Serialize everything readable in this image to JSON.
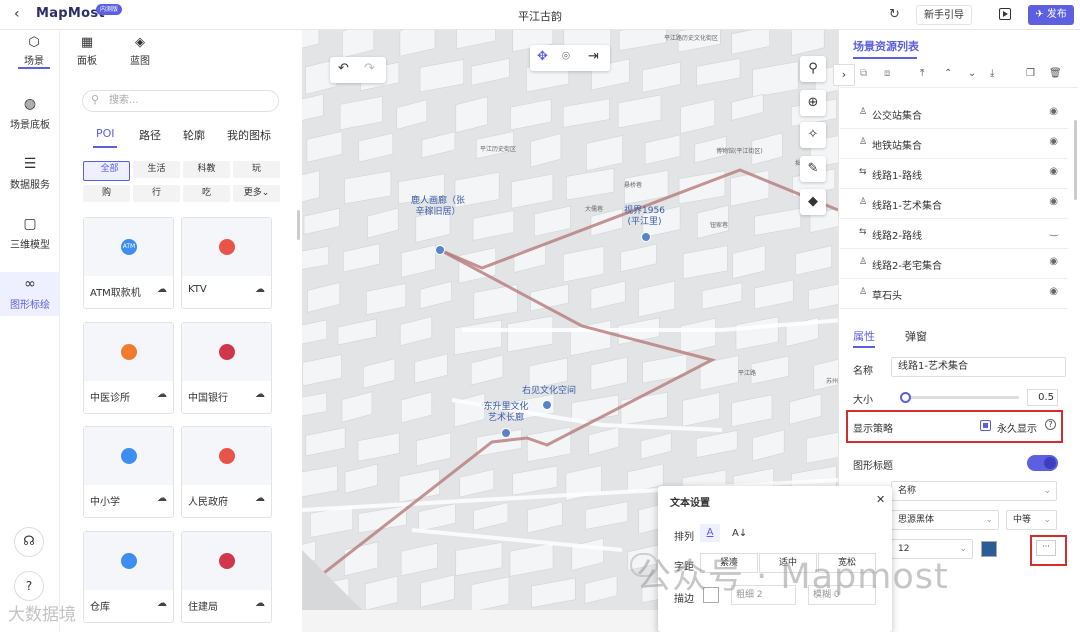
{
  "app": {
    "logo": "MapMost",
    "badge": "内测版",
    "title": "平江古韵",
    "guide_button": "新手引导",
    "publish_button": "发布"
  },
  "top_tabs": [
    {
      "label": "场景"
    },
    {
      "label": "面板"
    },
    {
      "label": "蓝图"
    }
  ],
  "rail": [
    {
      "label": "场景底板"
    },
    {
      "label": "数据服务"
    },
    {
      "label": "三维模型"
    },
    {
      "label": "图形标绘"
    }
  ],
  "search": {
    "placeholder": "搜索..."
  },
  "poi_tabs": [
    "POI",
    "路径",
    "轮廓",
    "我的图标"
  ],
  "chips": [
    "全部",
    "生活",
    "科教",
    "玩",
    "购",
    "行",
    "吃",
    "更多"
  ],
  "cards": [
    {
      "label": "ATM取款机",
      "icon_text": "ATM",
      "color": "#3d8ef0"
    },
    {
      "label": "KTV",
      "icon_text": "",
      "color": "#e8534a"
    },
    {
      "label": "中医诊所",
      "icon_text": "",
      "color": "#f07a2d"
    },
    {
      "label": "中国银行",
      "icon_text": "",
      "color": "#d1364c"
    },
    {
      "label": "中小学",
      "icon_text": "",
      "color": "#3d8ef0"
    },
    {
      "label": "人民政府",
      "icon_text": "",
      "color": "#e8534a"
    },
    {
      "label": "仓库",
      "icon_text": "",
      "color": "#3d8ef0"
    },
    {
      "label": "住建局",
      "icon_text": "",
      "color": "#d1364c"
    }
  ],
  "map": {
    "labels": [
      {
        "text": "鹿人画廊（张\n辛稼旧居）"
      },
      {
        "text": "视界1956\n(平江里)"
      },
      {
        "text": "右见文化空间"
      },
      {
        "text": "东升里文化\n艺术长廊"
      }
    ],
    "small_labels": [
      "平江路历史文化街区",
      "平江历史街区",
      "博物馆(平江街区)",
      "悬桥巷",
      "大儒巷",
      "钮家巷",
      "拙政园",
      "苏州",
      "平江路"
    ]
  },
  "resources": {
    "title": "场景资源列表",
    "layers": [
      {
        "name": "公交站集合",
        "visible": true
      },
      {
        "name": "地铁站集合",
        "visible": true
      },
      {
        "name": "线路1-路线",
        "visible": true
      },
      {
        "name": "线路1-艺术集合",
        "visible": true
      },
      {
        "name": "线路2-路线",
        "visible": false
      },
      {
        "name": "线路2-老宅集合",
        "visible": true
      },
      {
        "name": "草石头",
        "visible": true
      }
    ]
  },
  "props": {
    "tabs": [
      "属性",
      "弹窗"
    ],
    "name_label": "名称",
    "name_value": "线路1-艺术集合",
    "size_label": "大小",
    "size_value": "0.5",
    "strategy_label": "显示策略",
    "strategy_option": "永久显示",
    "title_label": "图形标题",
    "field": "名称",
    "font": "思源黑体",
    "weight": "中等",
    "font_size": "12",
    "ellipsis": "···"
  },
  "text_dialog": {
    "title": "文本设置",
    "arrange_label": "排列",
    "spacing_label": "字距",
    "spacing_options": [
      "紧凑",
      "适中",
      "宽松"
    ],
    "stroke_label": "描边",
    "thickness_label": "粗细",
    "thickness_value": "2",
    "blur_label": "模糊",
    "blur_value": "0"
  },
  "watermark": {
    "text": "公众号 · Mapmost",
    "corner": "大数据境"
  }
}
